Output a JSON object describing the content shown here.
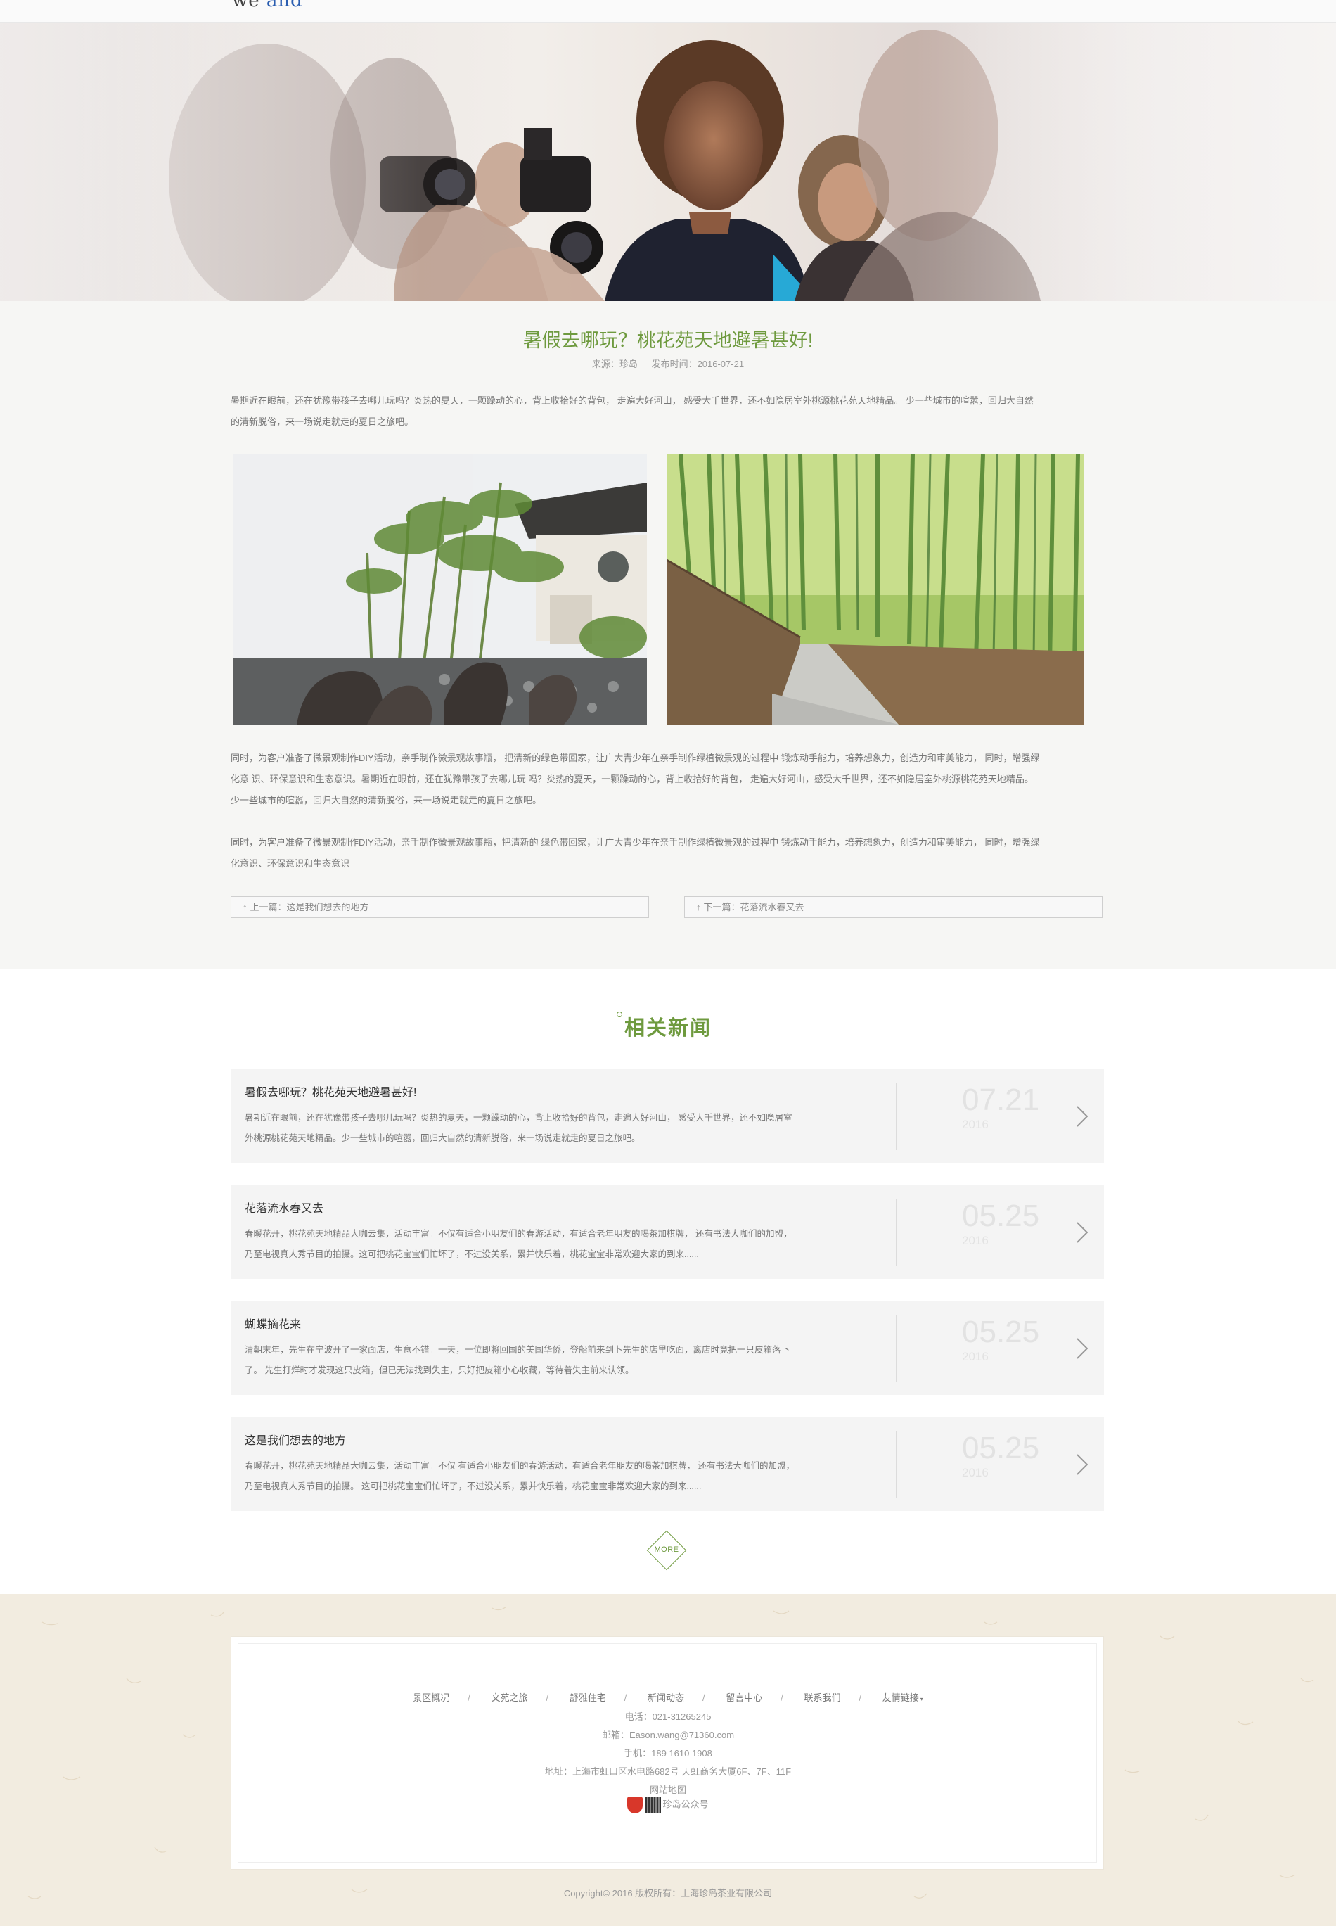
{
  "header": {
    "logo_fragment": "we",
    "logo_fragment_accent": "and"
  },
  "article": {
    "title": "暑假去哪玩？桃花苑天地避暑甚好!",
    "source": "来源：珍岛",
    "date": "发布时间：2016-07-21",
    "intro_line1": "暑期近在眼前，还在犹豫带孩子去哪儿玩吗？炎热的夏天，一颗躁动的心，背上收拾好的背包，  走遍大好河山，  感受大千世界，还不如隐居室外桃源桃花苑天地精品。  少一些城市的喧嚣，回归大自然",
    "intro_line2": "的清新脱俗，来一场说走就走的夏日之旅吧。",
    "body1_line1": "同时，为客户准备了微景观制作DIY活动，亲手制作微景观故事瓶，  把清新的绿色带回家，让广大青少年在亲手制作绿植微景观的过程中 锻炼动手能力，培养想象力，创造力和审美能力，  同时，增强绿",
    "body1_line2": "化意 识、环保意识和生态意识。暑期近在眼前，还在犹豫带孩子去哪儿玩 吗？炎热的夏天，一颗躁动的心，背上收拾好的背包，  走遍大好河山，感受大千世界，还不如隐居室外桃源桃花苑天地精品。",
    "body1_line3": "少一些城市的喧嚣，回归大自然的清新脱俗，来一场说走就走的夏日之旅吧。",
    "body2_line1": "同时，为客户准备了微景观制作DIY活动，亲手制作微景观故事瓶，把清新的 绿色带回家，让广大青少年在亲手制作绿植微景观的过程中 锻炼动手能力，培养想象力，创造力和审美能力，  同时，增强绿",
    "body2_line2": "化意识、环保意识和生态意识",
    "prev": "上一篇：这是我们想去的地方",
    "next": "下一篇：花落流水春又去"
  },
  "related": {
    "title": "相关新闻",
    "items": [
      {
        "title": "暑假去哪玩？桃花苑天地避暑甚好!",
        "desc1": "暑期近在眼前，还在犹豫带孩子去哪儿玩吗？炎热的夏天，一颗躁动的心，背上收拾好的背包，走遍大好河山，  感受大千世界，还不如隐居室",
        "desc2": "外桃源桃花苑天地精品。少一些城市的喧嚣，回归大自然的清新脱俗，来一场说走就走的夏日之旅吧。",
        "date": "07.21",
        "year": "2016"
      },
      {
        "title": "花落流水春又去",
        "desc1": "春暖花开，桃花苑天地精品大咖云集，活动丰富。不仅有适合小朋友们的春游活动，有适合老年朋友的喝茶加棋牌，  还有书法大咖们的加盟，",
        "desc2": "乃至电视真人秀节目的拍摄。这可把桃花宝宝们忙坏了，不过没关系，累并快乐着，桃花宝宝非常欢迎大家的到来......",
        "date": "05.25",
        "year": "2016"
      },
      {
        "title": "蝴蝶摘花来",
        "desc1": "清朝末年，先生在宁波开了一家面店，生意不错。一天，一位即将回国的美国华侨，登船前来到卜先生的店里吃面，离店时竟把一只皮箱落下",
        "desc2": "了。  先生打烊时才发现这只皮箱，但已无法找到失主，只好把皮箱小心收藏，等待着失主前来认领。",
        "date": "05.25",
        "year": "2016"
      },
      {
        "title": "这是我们想去的地方",
        "desc1": "春暖花开，桃花苑天地精品大咖云集，活动丰富。不仅 有适合小朋友们的春游活动，有适合老年朋友的喝茶加棋牌，  还有书法大咖们的加盟，",
        "desc2": "乃至电视真人秀节目的拍摄。  这可把桃花宝宝们忙坏了，不过没关系，累并快乐着，桃花宝宝非常欢迎大家的到来......",
        "date": "05.25",
        "year": "2016"
      }
    ],
    "more_label": "MORE"
  },
  "footer": {
    "nav": [
      "景区概况",
      "文苑之旅",
      "舒雅住宅",
      "新闻动态",
      "留言中心",
      "联系我们",
      "友情链接"
    ],
    "sep": "/",
    "phone": "电话：021-31265245",
    "email": "邮箱：Eason.wang@71360.com",
    "mobile": "手机：189 1610 1908",
    "address": "地址：上海市虹口区水电路682号 天虹商务大厦6F、7F、11F",
    "sitemap": "网站地图",
    "wechat": "珍岛公众号",
    "copyright": "Copyright© 2016 版权所有：上海珍岛茶业有限公司"
  },
  "colors": {
    "accent": "#6e9a3e",
    "footer_bg": "#f2ece0",
    "section_bg": "#f6f6f4"
  }
}
